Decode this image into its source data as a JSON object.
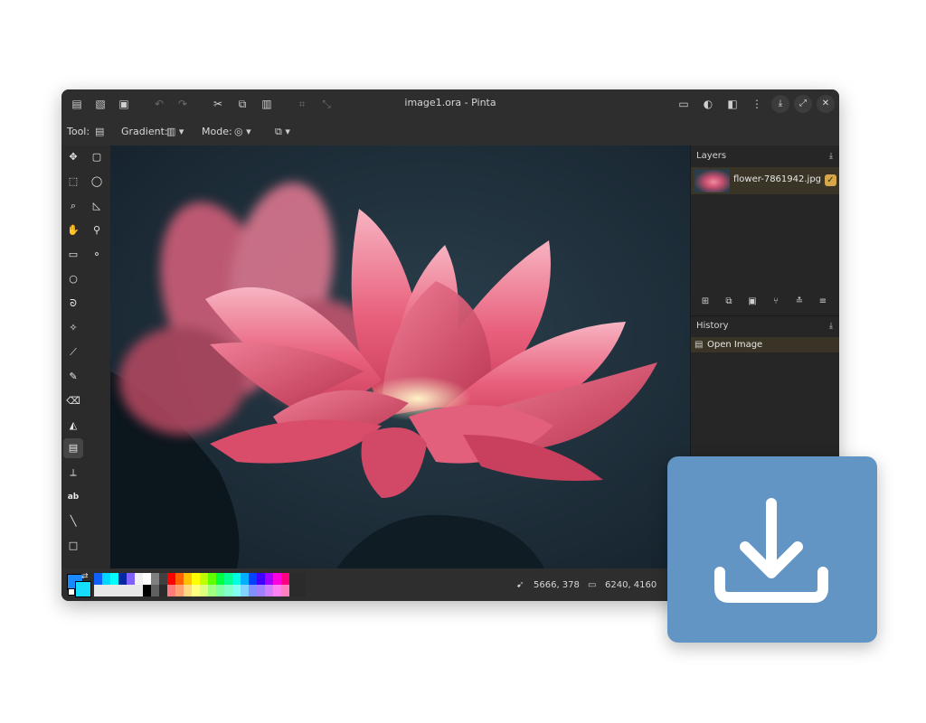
{
  "window": {
    "title": "image1.ora - Pinta"
  },
  "titlebar": {
    "left_icons": [
      "new-file-icon",
      "new-screenshot-icon",
      "save-icon",
      "undo-icon",
      "redo-icon",
      "cut-icon",
      "copy-icon",
      "paste-icon",
      "crop-icon",
      "resize-icon"
    ],
    "right_icons": [
      "image-menu-icon",
      "adjustments-icon",
      "effects-icon",
      "main-menu-icon"
    ]
  },
  "toolbar": {
    "tool_label": "Tool:",
    "gradient_label": "Gradient:",
    "mode_label": "Mode:"
  },
  "tools": [
    "move-selected-icon",
    "move-selection-icon",
    "zoom-icon",
    "pan-icon",
    "rectangle-select-icon",
    "ellipse-select-icon",
    "lasso-select-icon",
    "magic-wand-icon",
    "paintbrush-icon",
    "pencil-icon",
    "eraser-icon",
    "paint-bucket-icon",
    "gradient-icon",
    "color-picker-icon",
    "text-icon",
    "line-curve-icon",
    "rectangle-icon",
    "rounded-rectangle-icon",
    "ellipse-icon",
    "freeform-shape-icon",
    "clone-stamp-icon",
    "recolor-icon"
  ],
  "tool_text": {
    "text_tool_glyph": "ab"
  },
  "layers": {
    "title": "Layers",
    "items": [
      {
        "name": "flower-7861942.jpg",
        "visible": true
      }
    ]
  },
  "history": {
    "title": "History",
    "items": [
      {
        "label": "Open Image"
      }
    ]
  },
  "status": {
    "cursor_position": "5666, 378",
    "selection_size": "6240, 4160"
  },
  "colors": {
    "primary": "#1a8aff",
    "secondary": "#16dcff",
    "accent": "#d7a64a",
    "download_tile": "#6295c4"
  }
}
